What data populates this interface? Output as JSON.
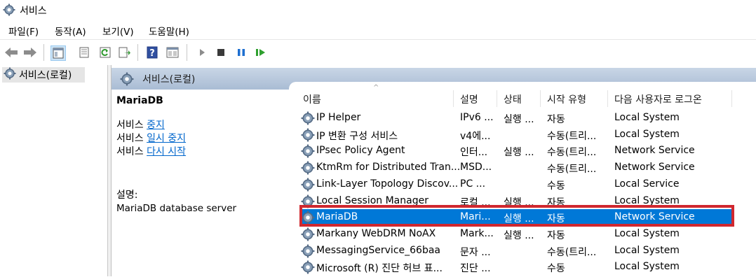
{
  "window": {
    "title": "서비스"
  },
  "menu": {
    "items": [
      "파일(F)",
      "동작(A)",
      "보기(V)",
      "도움말(H)"
    ]
  },
  "toolbar": {
    "icons": [
      "back-arrow-icon",
      "forward-arrow-icon",
      "show-tree-icon",
      "properties-icon",
      "refresh-icon",
      "export-list-icon",
      "help-icon",
      "view-icon",
      "start-icon",
      "stop-icon",
      "pause-icon",
      "resume-icon"
    ]
  },
  "tree": {
    "root": "서비스(로컬)"
  },
  "header": {
    "title": "서비스(로컬)"
  },
  "detail": {
    "name": "MariaDB",
    "actions": [
      {
        "prefix": "서비스 ",
        "link": "중지"
      },
      {
        "prefix": "서비스 ",
        "link": "일시 중지"
      },
      {
        "prefix": "서비스 ",
        "link": "다시 시작"
      }
    ],
    "description_label": "설명:",
    "description": "MariaDB database server"
  },
  "table": {
    "columns": [
      "이름",
      "설명",
      "상태",
      "시작 유형",
      "다음 사용자로 로그온"
    ],
    "rows": [
      {
        "name": "IP Helper",
        "desc": "IPv6 ...",
        "status": "실행 ...",
        "startup": "자동",
        "logon": "Local System"
      },
      {
        "name": "IP 변환 구성 서비스",
        "desc": "v4에...",
        "status": "",
        "startup": "수동(트리...",
        "logon": "Local System"
      },
      {
        "name": "IPsec Policy Agent",
        "desc": "인터...",
        "status": "실행 ...",
        "startup": "수동(트리...",
        "logon": "Network Service"
      },
      {
        "name": "KtmRm for Distributed Tran...",
        "desc": "MSD...",
        "status": "",
        "startup": "수동(트리...",
        "logon": "Network Service"
      },
      {
        "name": "Link-Layer Topology Discov...",
        "desc": "PC ...",
        "status": "",
        "startup": "수동",
        "logon": "Local Service"
      },
      {
        "name": "Local Session Manager",
        "desc": "로컬 ...",
        "status": "실행 ...",
        "startup": "자동",
        "logon": "Local System"
      },
      {
        "name": "MariaDB",
        "desc": "Mari...",
        "status": "실행 ...",
        "startup": "자동",
        "logon": "Network Service"
      },
      {
        "name": "Markany WebDRM NoAX",
        "desc": "Mark...",
        "status": "실행 ...",
        "startup": "자동",
        "logon": "Local System"
      },
      {
        "name": "MessagingService_66baa",
        "desc": "문자 ...",
        "status": "",
        "startup": "수동(트리...",
        "logon": "Local System"
      },
      {
        "name": "Microsoft (R) 진단 허브 표...",
        "desc": "진단 ...",
        "status": "",
        "startup": "수동",
        "logon": "Local System"
      }
    ],
    "selected_row": 6
  },
  "colors": {
    "selection": "#0078d7",
    "highlight_border": "#d0282f",
    "link": "#0066cc"
  }
}
